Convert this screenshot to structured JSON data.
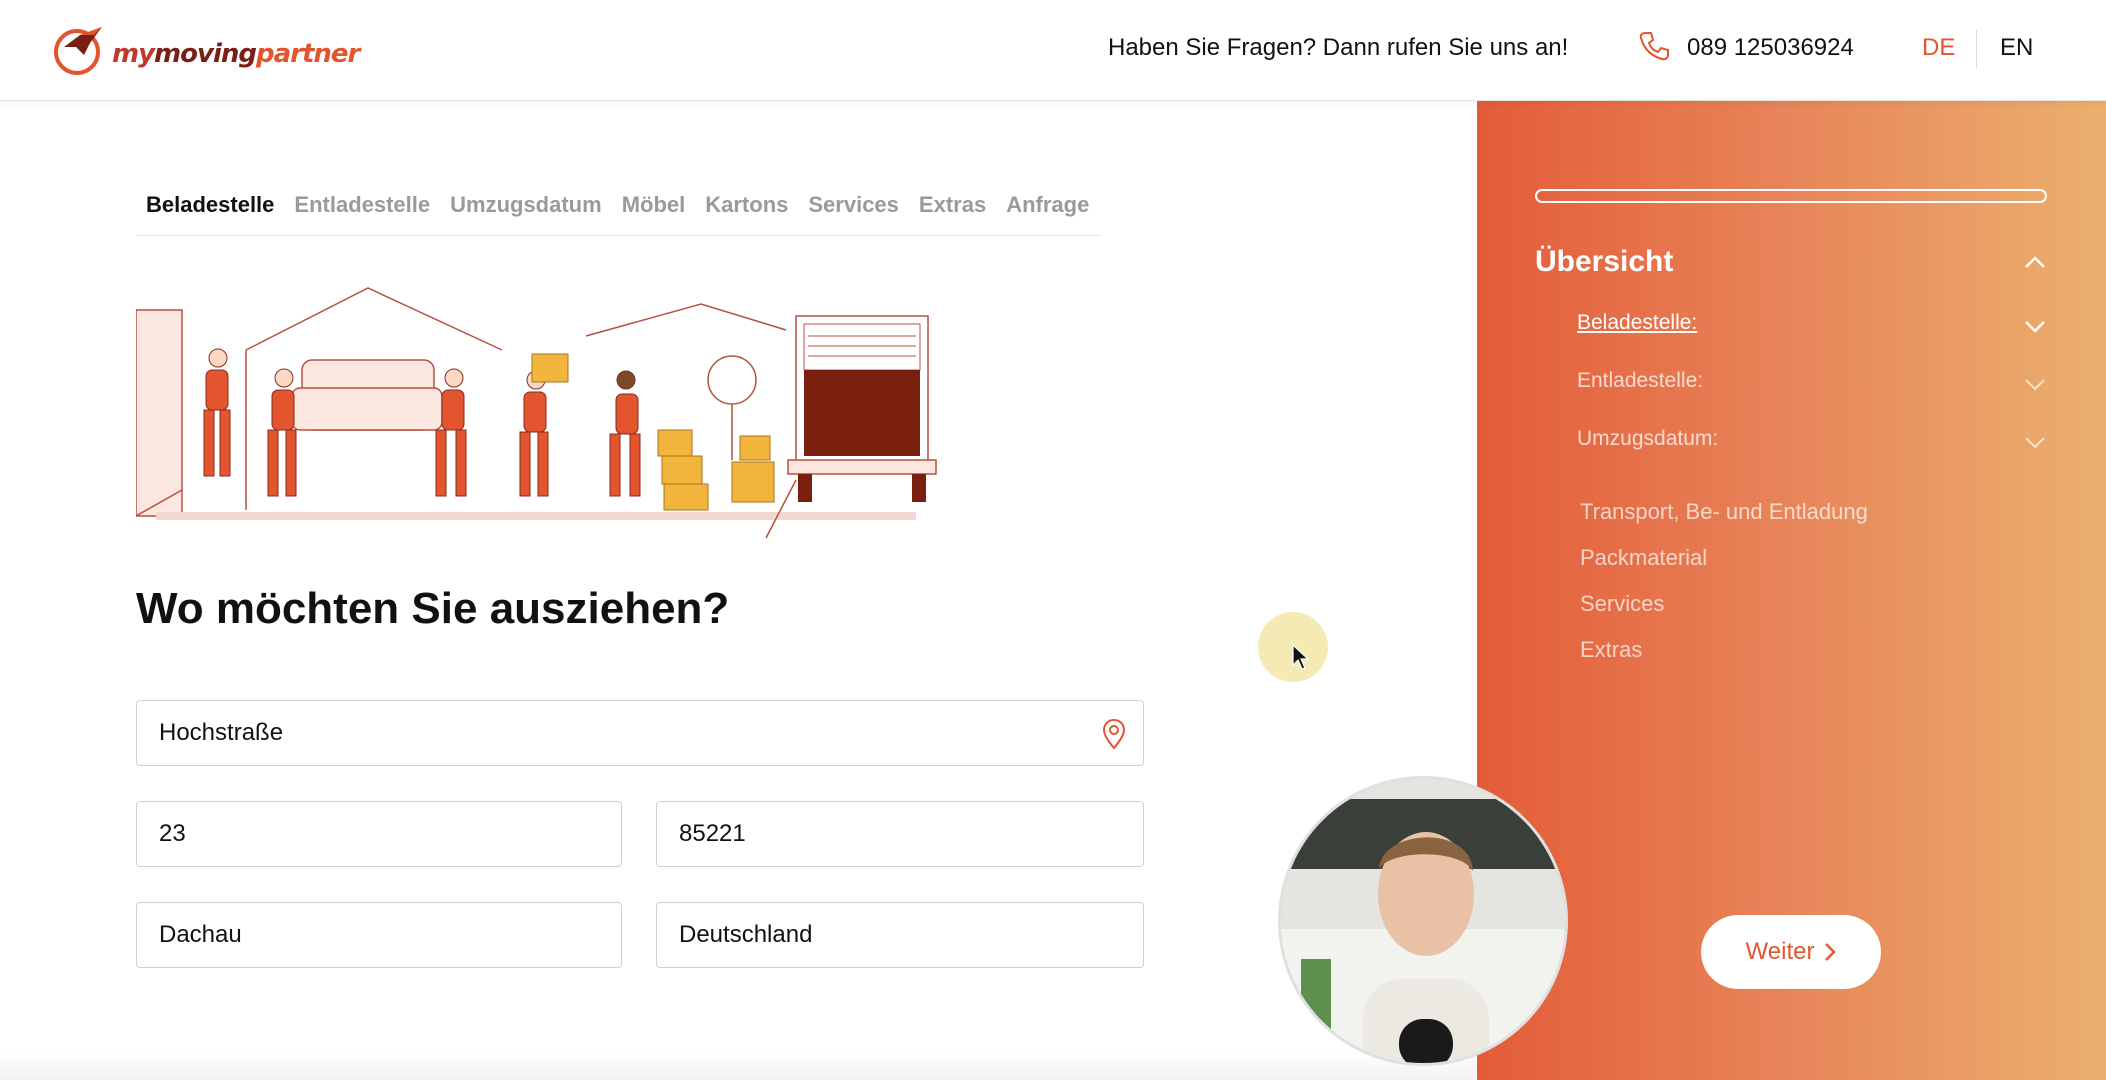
{
  "header": {
    "logo_parts": [
      "my",
      "moving",
      "partner"
    ],
    "help_text": "Haben Sie Fragen? Dann rufen Sie uns an!",
    "phone": "089 125036924",
    "languages": [
      "DE",
      "EN"
    ],
    "active_language": "DE"
  },
  "steps": [
    "Beladestelle",
    "Entladestelle",
    "Umzugsdatum",
    "Möbel",
    "Kartons",
    "Services",
    "Extras",
    "Anfrage"
  ],
  "form": {
    "heading_regular": "Wo möchten Sie ",
    "heading_bold": "ausziehen?",
    "street": "Hochstraße",
    "house_number": "23",
    "postal_code": "85221",
    "city": "Dachau",
    "country": "Deutschland"
  },
  "sidebar": {
    "progress": 0,
    "title": "Übersicht",
    "items": [
      "Beladestelle:",
      "Entladestelle:",
      "Umzugsdatum:"
    ],
    "sub_items": [
      "Transport, Be- und Entladung",
      "Packmaterial",
      "Services",
      "Extras"
    ],
    "next_label": "Weiter"
  },
  "colors": {
    "accent": "#e2552f",
    "sidebar_gradient_start": "#e35c38",
    "sidebar_gradient_end": "#ebb06d"
  }
}
